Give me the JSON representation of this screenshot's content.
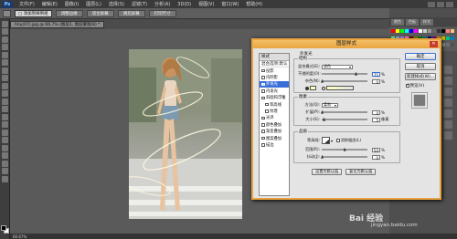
{
  "menubar": {
    "logo": "Ps",
    "items": [
      "文件(F)",
      "编辑(E)",
      "图像(I)",
      "图层(L)",
      "选择(S)",
      "滤镜(T)",
      "分析(A)",
      "3D(D)",
      "视图(V)",
      "窗口(W)",
      "帮助(H)"
    ]
  },
  "options": {
    "preset": "□ 添加到样例组",
    "btn1": "调整边缘",
    "btn2": "适合屏幕",
    "btn3": "填充屏幕",
    "btn4": "打印尺寸"
  },
  "document": {
    "tab": "hhy(07).jpg @ 66.7% (图层1, 图层蒙版/8) *",
    "status": "66.67%"
  },
  "right_panel": {
    "tabs": [
      "颜色",
      "色板",
      "样式"
    ]
  },
  "dialog": {
    "title": "图层样式",
    "close": "✕",
    "styles_header": "样式",
    "blend_header": "混合选项:默认",
    "fx": [
      {
        "label": "投影",
        "checked": false,
        "selected": false,
        "indent": false
      },
      {
        "label": "内阴影",
        "checked": false,
        "selected": false,
        "indent": false
      },
      {
        "label": "外发光",
        "checked": true,
        "selected": true,
        "indent": false
      },
      {
        "label": "内发光",
        "checked": false,
        "selected": false,
        "indent": false
      },
      {
        "label": "斜面和浮雕",
        "checked": false,
        "selected": false,
        "indent": false
      },
      {
        "label": "等高线",
        "checked": false,
        "selected": false,
        "indent": true
      },
      {
        "label": "纹理",
        "checked": false,
        "selected": false,
        "indent": true
      },
      {
        "label": "光泽",
        "checked": false,
        "selected": false,
        "indent": false
      },
      {
        "label": "颜色叠加",
        "checked": false,
        "selected": false,
        "indent": false
      },
      {
        "label": "渐变叠加",
        "checked": false,
        "selected": false,
        "indent": false
      },
      {
        "label": "图案叠加",
        "checked": false,
        "selected": false,
        "indent": false
      },
      {
        "label": "描边",
        "checked": false,
        "selected": false,
        "indent": false
      }
    ],
    "outer_glow": {
      "title": "外发光",
      "structure_title": "结构",
      "blend_mode_label": "混合模式(E):",
      "blend_mode": "滤色",
      "opacity_label": "不透明度(O):",
      "opacity": "75",
      "noise_label": "杂色(N):",
      "noise": "0",
      "pct": "%"
    },
    "elements": {
      "title": "图素",
      "method_label": "方法(Q):",
      "method": "柔和",
      "spread_label": "扩展(P):",
      "spread": "0",
      "size_label": "大小(S):",
      "size": "5",
      "px": "像素"
    },
    "quality": {
      "title": "品质",
      "contour_label": "等高线:",
      "antialias_label": "消除锯齿(L)",
      "range_label": "范围(R):",
      "range": "50",
      "jitter_label": "抖动(J):",
      "jitter": "0"
    },
    "buttons": {
      "make_default": "设置为默认值",
      "reset_default": "复位为默认值",
      "ok": "确定",
      "cancel": "取消",
      "new_style": "新建样式(W)...",
      "preview": "预览(V)"
    }
  },
  "watermark": {
    "brand": "Bai 经验",
    "url": "jingyan.baidu.com"
  },
  "colors": {
    "dialog_border": "#e9a441",
    "selection": "#3a6fd8",
    "glow_color": "#ffffbe"
  }
}
